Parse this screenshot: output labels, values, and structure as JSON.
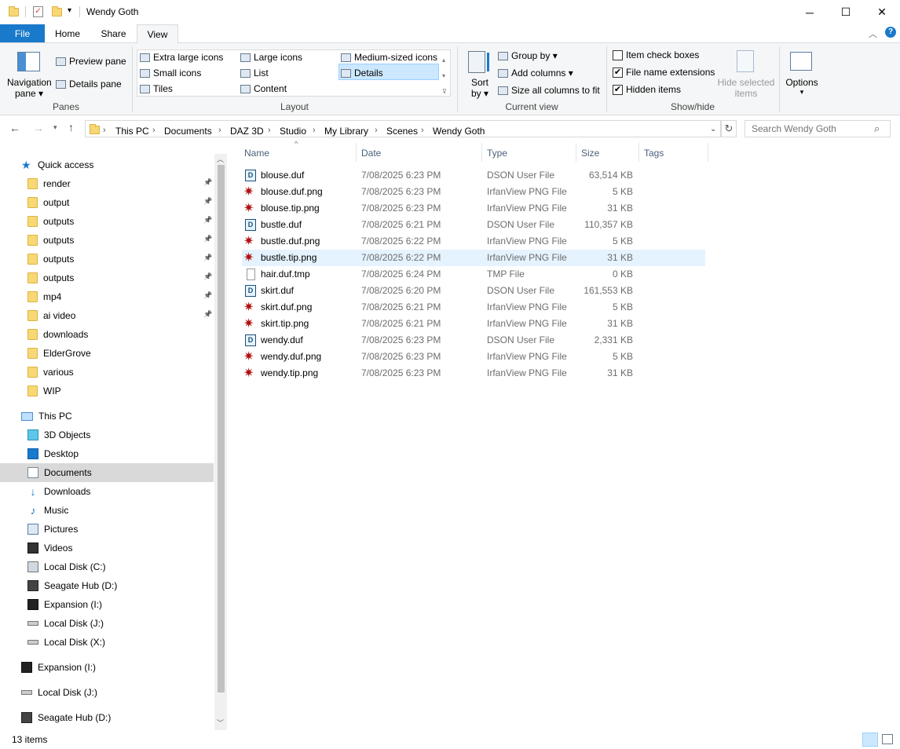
{
  "window": {
    "title": "Wendy Goth",
    "min": "─",
    "max": "☐",
    "close": "✕"
  },
  "tabs": [
    {
      "label": "File"
    },
    {
      "label": "Home"
    },
    {
      "label": "Share"
    },
    {
      "label": "View"
    }
  ],
  "ribbon": {
    "panes": {
      "navigation_pane": "Navigation",
      "navigation_pane2": "pane ▾",
      "preview_pane": "Preview pane",
      "details_pane": "Details pane",
      "label": "Panes"
    },
    "layout": {
      "items": [
        "Extra large icons",
        "Large icons",
        "Medium-sized icons",
        "Small icons",
        "List",
        "Details",
        "Tiles",
        "Content"
      ],
      "selected": "Details",
      "label": "Layout"
    },
    "current_view": {
      "sort": "Sort",
      "sort2": "by ▾",
      "group_by": "Group by ▾",
      "add_columns": "Add columns ▾",
      "size_cols": "Size all columns to fit",
      "label": "Current view"
    },
    "show_hide": {
      "item_check_boxes": "Item check boxes",
      "file_name_ext": "File name extensions",
      "hidden_items": "Hidden items",
      "item_check_boxes_checked": false,
      "file_name_ext_checked": true,
      "hidden_items_checked": true,
      "hide_selected": "Hide selected",
      "hide_selected2": "items",
      "label": "Show/hide"
    },
    "options": {
      "label": "Options"
    }
  },
  "address": {
    "crumbs": [
      "This PC",
      "Documents",
      "DAZ 3D",
      "Studio",
      "My Library",
      "Scenes",
      "Wendy Goth"
    ],
    "search_placeholder": "Search Wendy Goth"
  },
  "sidebar": {
    "quick_access": "Quick access",
    "quick_items": [
      {
        "label": "render",
        "pinned": true
      },
      {
        "label": "output",
        "pinned": true
      },
      {
        "label": "outputs",
        "pinned": true
      },
      {
        "label": "outputs",
        "pinned": true
      },
      {
        "label": "outputs",
        "pinned": true
      },
      {
        "label": "outputs",
        "pinned": true
      },
      {
        "label": "mp4",
        "pinned": true
      },
      {
        "label": "ai video",
        "pinned": true
      },
      {
        "label": "downloads",
        "pinned": false
      },
      {
        "label": "ElderGrove",
        "pinned": false
      },
      {
        "label": "various",
        "pinned": false
      },
      {
        "label": "WIP",
        "pinned": false
      }
    ],
    "this_pc": "This PC",
    "pc_items": [
      "3D Objects",
      "Desktop",
      "Documents",
      "Downloads",
      "Music",
      "Pictures",
      "Videos",
      "Local Disk (C:)",
      "Seagate Hub (D:)",
      "Expansion (I:)",
      "Local Disk (J:)",
      "Local Disk (X:)"
    ],
    "drives": [
      "Expansion (I:)",
      "Local Disk (J:)",
      "Seagate Hub (D:)"
    ]
  },
  "columns": {
    "name": "Name",
    "date": "Date",
    "type": "Type",
    "size": "Size",
    "tags": "Tags"
  },
  "files": [
    {
      "name": "blouse.duf",
      "date": "7/08/2025 6:23 PM",
      "type": "DSON User File",
      "size": "63,514 KB",
      "kind": "duf"
    },
    {
      "name": "blouse.duf.png",
      "date": "7/08/2025 6:23 PM",
      "type": "IrfanView PNG File",
      "size": "5 KB",
      "kind": "png"
    },
    {
      "name": "blouse.tip.png",
      "date": "7/08/2025 6:23 PM",
      "type": "IrfanView PNG File",
      "size": "31 KB",
      "kind": "png"
    },
    {
      "name": "bustle.duf",
      "date": "7/08/2025 6:21 PM",
      "type": "DSON User File",
      "size": "110,357 KB",
      "kind": "duf"
    },
    {
      "name": "bustle.duf.png",
      "date": "7/08/2025 6:22 PM",
      "type": "IrfanView PNG File",
      "size": "5 KB",
      "kind": "png"
    },
    {
      "name": "bustle.tip.png",
      "date": "7/08/2025 6:22 PM",
      "type": "IrfanView PNG File",
      "size": "31 KB",
      "kind": "png"
    },
    {
      "name": "hair.duf.tmp",
      "date": "7/08/2025 6:24 PM",
      "type": "TMP File",
      "size": "0 KB",
      "kind": "tmp"
    },
    {
      "name": "skirt.duf",
      "date": "7/08/2025 6:20 PM",
      "type": "DSON User File",
      "size": "161,553 KB",
      "kind": "duf"
    },
    {
      "name": "skirt.duf.png",
      "date": "7/08/2025 6:21 PM",
      "type": "IrfanView PNG File",
      "size": "5 KB",
      "kind": "png"
    },
    {
      "name": "skirt.tip.png",
      "date": "7/08/2025 6:21 PM",
      "type": "IrfanView PNG File",
      "size": "31 KB",
      "kind": "png"
    },
    {
      "name": "wendy.duf",
      "date": "7/08/2025 6:23 PM",
      "type": "DSON User File",
      "size": "2,331 KB",
      "kind": "duf"
    },
    {
      "name": "wendy.duf.png",
      "date": "7/08/2025 6:23 PM",
      "type": "IrfanView PNG File",
      "size": "5 KB",
      "kind": "png"
    },
    {
      "name": "wendy.tip.png",
      "date": "7/08/2025 6:23 PM",
      "type": "IrfanView PNG File",
      "size": "31 KB",
      "kind": "png"
    }
  ],
  "hovered_row": 5,
  "status": {
    "count": "13 items"
  },
  "colors": {
    "accent": "#1979ca",
    "selected_bg": "#cce8ff",
    "hover_bg": "#e5f3ff",
    "nav_selected": "#d9d9d9"
  }
}
